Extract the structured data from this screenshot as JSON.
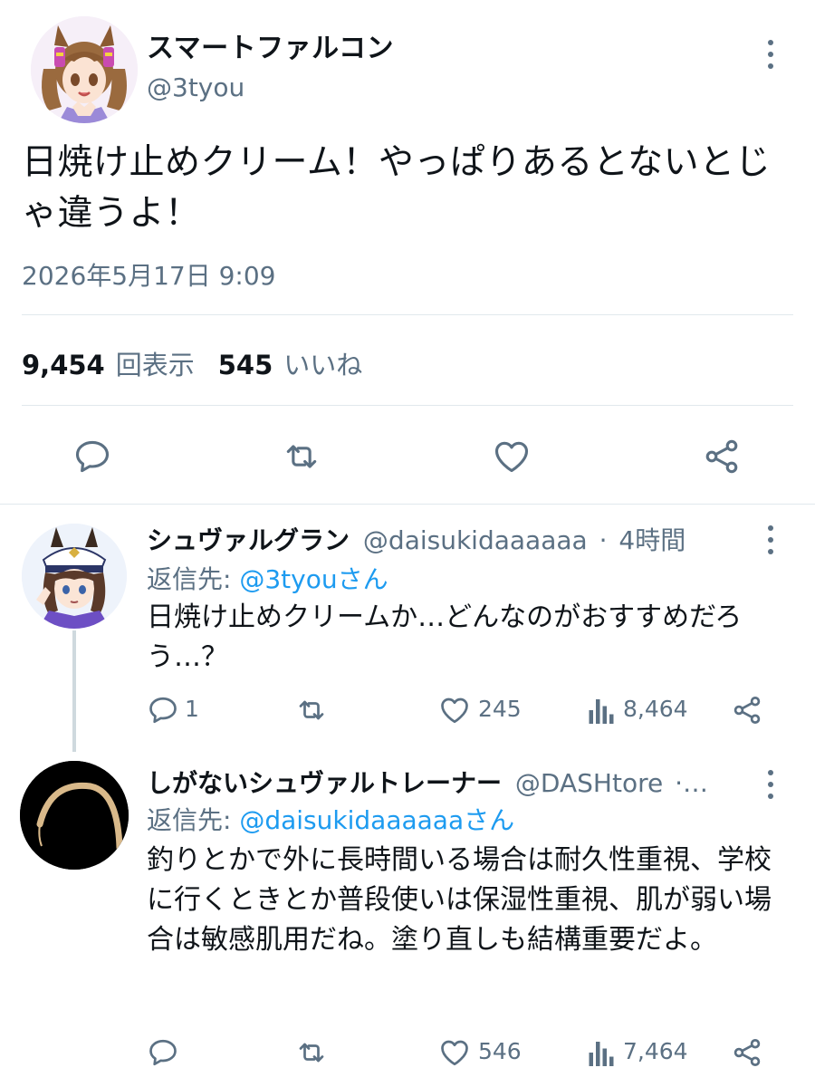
{
  "main_tweet": {
    "display_name": "スマートファルコン",
    "handle": "@3tyou",
    "text": "日焼け止めクリーム！やっぱりあるとないとじゃ違うよ！",
    "timestamp": "2026年5月17日 9:09",
    "views_count": "9,454",
    "views_label": "回表示",
    "likes_count": "545",
    "likes_label": "いいね"
  },
  "replies": [
    {
      "display_name": "シュヴァルグラン",
      "handle": "@daisukidaaaaaa",
      "sep": "·",
      "time": "4時間",
      "reply_prefix": "返信先: ",
      "reply_to": "@3tyouさん",
      "text": "日焼け止めクリームか…どんなのがおすすめだろう…？",
      "reply_count": "1",
      "like_count": "245",
      "view_count": "8,464"
    },
    {
      "display_name": "しがないシュヴァルトレーナー",
      "handle": "@DASHtore",
      "sep": "·…",
      "reply_prefix": "返信先: ",
      "reply_to": "@daisukidaaaaaaさん",
      "text": "釣りとかで外に長時間いる場合は耐久性重視、学校に行くときとか普段使いは保湿性重視、肌が弱い場合は敏感肌用だね。塗り直しも結構重要だよ。",
      "like_count": "546",
      "view_count": "7,464"
    }
  ],
  "colors": {
    "text": "#0f1419",
    "secondary": "#5b7083",
    "link": "#1d9bf0",
    "divider": "#e1e8ed",
    "thread_line": "#cfd9de"
  },
  "icons": [
    "more-icon",
    "reply-icon",
    "retweet-icon",
    "like-icon",
    "views-icon",
    "share-icon"
  ]
}
